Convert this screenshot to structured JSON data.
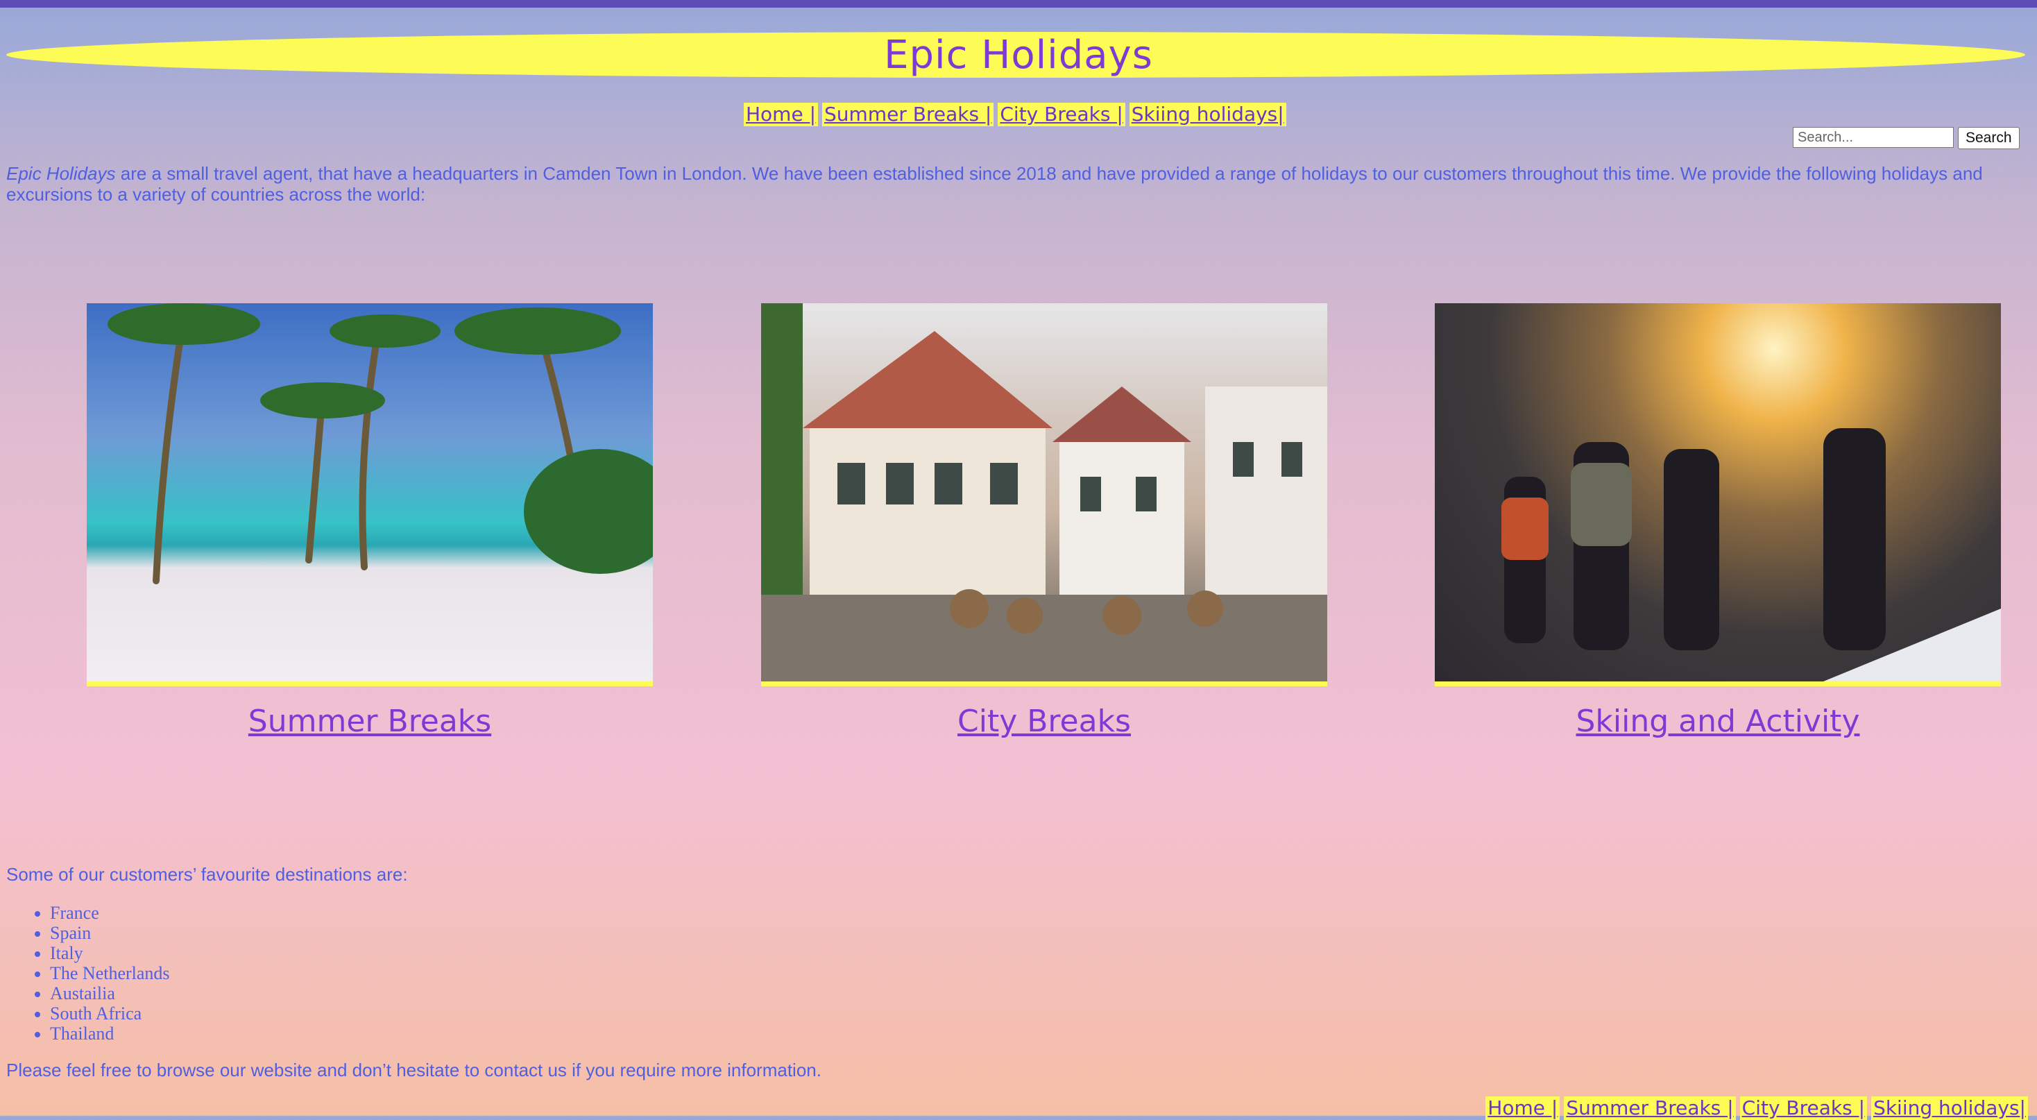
{
  "site": {
    "title": "Epic Holidays"
  },
  "nav_top": [
    "Home |",
    "Summer Breaks |",
    "City Breaks |",
    "Skiing holidays|"
  ],
  "nav_bottom": [
    "Home |",
    "Summer Breaks |",
    "City Breaks |",
    "Skiing holidays|"
  ],
  "search": {
    "placeholder": "Search...",
    "button": "Search"
  },
  "intro": {
    "brand": "Epic Holidays",
    "text": " are a small travel agent, that have a headquarters in Camden Town in London. We have been established since 2018 and have provided a range of holidays to our customers throughout this time. We provide the following holidays and excursions to a variety of countries across the world:"
  },
  "cards": [
    {
      "caption": "Summer Breaks",
      "image": "beach-photo"
    },
    {
      "caption": "City Breaks",
      "image": "city-photo"
    },
    {
      "caption": "Skiing and Activity",
      "image": "ski-photo"
    }
  ],
  "destinations": {
    "label": "Some of our customers’ favourite destinations are:",
    "items": [
      "France",
      "Spain",
      "Italy",
      "The Netherlands",
      "Austailia",
      "South Africa",
      "Thailand"
    ]
  },
  "outro": "Please feel free to browse our website and don’t hesitate to contact us if you require more information.",
  "colors": {
    "accent": "#7e3bd4",
    "highlight": "#fdfb55",
    "text": "#4f5fe0",
    "topbar": "#5b4cb6"
  }
}
